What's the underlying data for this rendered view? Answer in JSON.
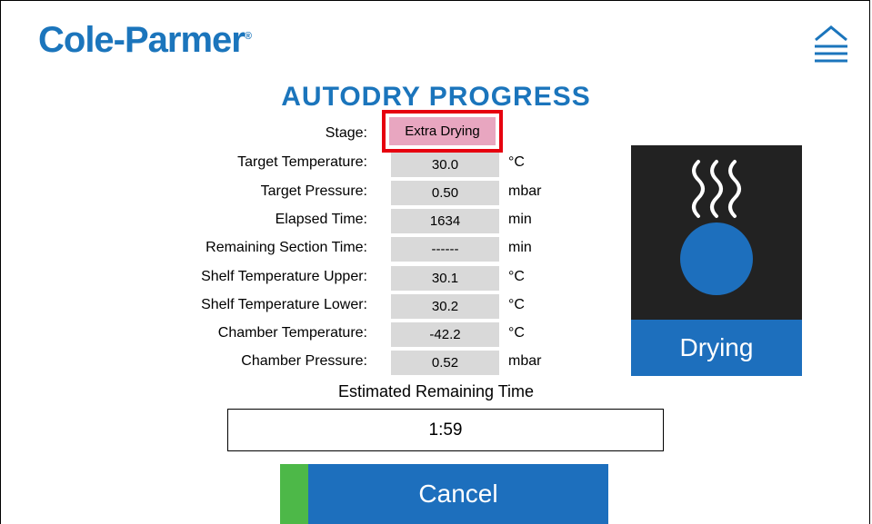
{
  "header": {
    "logo_text": "Cole-Parmer",
    "logo_mark": "®",
    "menu_icon": "eject-menu-icon",
    "brand_color": "#1b75bc"
  },
  "title": "AUTODRY PROGRESS",
  "stage": {
    "label": "Stage:",
    "value": "Extra Drying",
    "highlight_color": "#e8a6c0",
    "outline_color": "#e6000f"
  },
  "rows": [
    {
      "label": "Target Temperature:",
      "value": "30.0",
      "unit": "°C"
    },
    {
      "label": "Target Pressure:",
      "value": "0.50",
      "unit": "mbar"
    },
    {
      "label": "Elapsed Time:",
      "value": "1634",
      "unit": "min"
    },
    {
      "label": "Remaining Section Time:",
      "value": "------",
      "unit": "min"
    },
    {
      "label": "Shelf Temperature Upper:",
      "value": "30.1",
      "unit": "°C"
    },
    {
      "label": "Shelf Temperature Lower:",
      "value": "30.2",
      "unit": "°C"
    },
    {
      "label": "Chamber Temperature:",
      "value": "-42.2",
      "unit": "°C"
    },
    {
      "label": "Chamber Pressure:",
      "value": "0.52",
      "unit": "mbar"
    }
  ],
  "status_panel": {
    "icon": "steam-drying-icon",
    "label": "Drying",
    "accent_color": "#1d6fbd"
  },
  "estimate": {
    "label": "Estimated Remaining Time",
    "value": "1:59"
  },
  "cancel_button": {
    "label": "Cancel",
    "accent_color": "#4db848"
  }
}
